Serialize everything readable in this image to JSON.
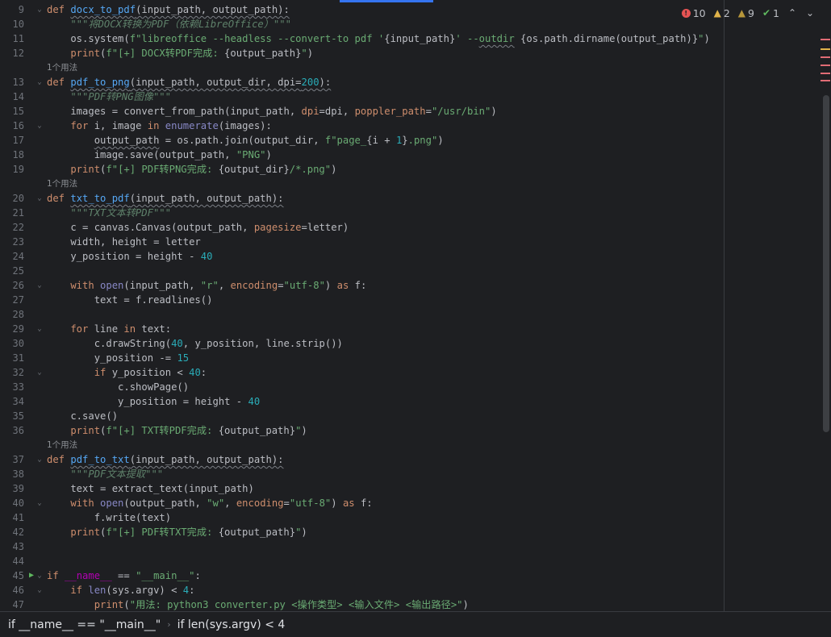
{
  "inspections": {
    "errors": "10",
    "warnings": "2",
    "weak_warnings": "9",
    "ok": "1"
  },
  "usage_hint": "1个用法",
  "breadcrumb": [
    "if __name__ == \"__main__\"",
    "if len(sys.argv) < 4"
  ],
  "lines": [
    {
      "n": "9",
      "fold": "⌄",
      "toks": [
        [
          "kw",
          "def "
        ],
        [
          "fn sq",
          "docx_to_pdf"
        ],
        [
          "plain sq",
          "(input_path, output_path):"
        ]
      ]
    },
    {
      "n": "10",
      "toks": [
        [
          "doc",
          "    \"\"\"将DOCX转换为PDF（依赖LibreOffice）\"\"\""
        ]
      ]
    },
    {
      "n": "11",
      "toks": [
        [
          "plain",
          "    os.system("
        ],
        [
          "str",
          "f\"libreoffice --headless --convert-to pdf '"
        ],
        [
          "plain",
          "{input_path}"
        ],
        [
          "str",
          "' --"
        ],
        [
          "str sq",
          "outdir"
        ],
        [
          "str",
          " "
        ],
        [
          "plain",
          "{os.path.dirname(output_path)}"
        ],
        [
          "str",
          "\""
        ],
        [
          "plain",
          ")"
        ]
      ]
    },
    {
      "n": "12",
      "toks": [
        [
          "kw",
          "    print"
        ],
        [
          "plain",
          "("
        ],
        [
          "str",
          "f\"[+] DOCX转PDF完成: "
        ],
        [
          "plain",
          "{output_path}"
        ],
        [
          "str",
          "\""
        ],
        [
          "plain",
          ")"
        ]
      ]
    },
    {
      "hint": true
    },
    {
      "n": "13",
      "fold": "⌄",
      "toks": [
        [
          "kw",
          "def "
        ],
        [
          "fn sq",
          "pdf_to_png"
        ],
        [
          "plain sq",
          "(input_path, output_dir, dpi="
        ],
        [
          "num sq",
          "200"
        ],
        [
          "plain sq",
          "):"
        ]
      ]
    },
    {
      "n": "14",
      "toks": [
        [
          "doc",
          "    \"\"\"PDF转PNG图像\"\"\""
        ]
      ]
    },
    {
      "n": "15",
      "toks": [
        [
          "plain",
          "    images = convert_from_path(input_path, "
        ],
        [
          "param",
          "dpi"
        ],
        [
          "plain",
          "=dpi, "
        ],
        [
          "param",
          "poppler_path"
        ],
        [
          "plain",
          "="
        ],
        [
          "str",
          "\"/usr/bin\""
        ],
        [
          "plain",
          ")"
        ]
      ]
    },
    {
      "n": "16",
      "fold": "⌄",
      "toks": [
        [
          "kw",
          "    for "
        ],
        [
          "plain",
          "i, image "
        ],
        [
          "kw",
          "in "
        ],
        [
          "builtin",
          "enumerate"
        ],
        [
          "plain",
          "(images):"
        ]
      ]
    },
    {
      "n": "17",
      "toks": [
        [
          "plain",
          "        "
        ],
        [
          "plain sq",
          "output_path"
        ],
        [
          "plain",
          " = os.path.join(output_dir, "
        ],
        [
          "str",
          "f\"page_"
        ],
        [
          "plain",
          "{i + "
        ],
        [
          "num",
          "1"
        ],
        [
          "plain",
          "}"
        ],
        [
          "str",
          ".png\""
        ],
        [
          "plain",
          ")"
        ]
      ]
    },
    {
      "n": "18",
      "toks": [
        [
          "plain",
          "        image.save(output_path, "
        ],
        [
          "str",
          "\"PNG\""
        ],
        [
          "plain",
          ")"
        ]
      ]
    },
    {
      "n": "19",
      "toks": [
        [
          "kw",
          "    print"
        ],
        [
          "plain",
          "("
        ],
        [
          "str",
          "f\"[+] PDF转PNG完成: "
        ],
        [
          "plain",
          "{output_dir}"
        ],
        [
          "str",
          "/*.png\""
        ],
        [
          "plain",
          ")"
        ]
      ]
    },
    {
      "hint": true
    },
    {
      "n": "20",
      "fold": "⌄",
      "toks": [
        [
          "kw",
          "def "
        ],
        [
          "fn sq",
          "txt_to_pdf"
        ],
        [
          "plain sq",
          "(input_path, output_path):"
        ]
      ]
    },
    {
      "n": "21",
      "toks": [
        [
          "doc",
          "    \"\"\"TXT文本转PDF\"\"\""
        ]
      ]
    },
    {
      "n": "22",
      "toks": [
        [
          "plain",
          "    c = canvas.Canvas(output_path, "
        ],
        [
          "param",
          "pagesize"
        ],
        [
          "plain",
          "=letter)"
        ]
      ]
    },
    {
      "n": "23",
      "toks": [
        [
          "plain",
          "    width, height = letter"
        ]
      ]
    },
    {
      "n": "24",
      "toks": [
        [
          "plain",
          "    y_position = height - "
        ],
        [
          "num",
          "40"
        ]
      ]
    },
    {
      "n": "25",
      "toks": []
    },
    {
      "n": "26",
      "fold": "⌄",
      "toks": [
        [
          "kw",
          "    with "
        ],
        [
          "builtin",
          "open"
        ],
        [
          "plain",
          "(input_path, "
        ],
        [
          "str",
          "\"r\""
        ],
        [
          "plain",
          ", "
        ],
        [
          "param",
          "encoding"
        ],
        [
          "plain",
          "="
        ],
        [
          "str",
          "\"utf-8\""
        ],
        [
          "plain",
          ") "
        ],
        [
          "kw",
          "as "
        ],
        [
          "plain",
          "f:"
        ]
      ]
    },
    {
      "n": "27",
      "toks": [
        [
          "plain",
          "        text = f.readlines()"
        ]
      ]
    },
    {
      "n": "28",
      "toks": []
    },
    {
      "n": "29",
      "fold": "⌄",
      "toks": [
        [
          "kw",
          "    for "
        ],
        [
          "plain",
          "line "
        ],
        [
          "kw",
          "in "
        ],
        [
          "plain",
          "text:"
        ]
      ]
    },
    {
      "n": "30",
      "toks": [
        [
          "plain",
          "        c.drawString("
        ],
        [
          "num",
          "40"
        ],
        [
          "plain",
          ", y_position, line.strip())"
        ]
      ]
    },
    {
      "n": "31",
      "toks": [
        [
          "plain",
          "        y_position -= "
        ],
        [
          "num",
          "15"
        ]
      ]
    },
    {
      "n": "32",
      "fold": "⌄",
      "toks": [
        [
          "kw",
          "        if "
        ],
        [
          "plain",
          "y_position < "
        ],
        [
          "num",
          "40"
        ],
        [
          "plain",
          ":"
        ]
      ]
    },
    {
      "n": "33",
      "toks": [
        [
          "plain",
          "            c.showPage()"
        ]
      ]
    },
    {
      "n": "34",
      "toks": [
        [
          "plain",
          "            y_position = height - "
        ],
        [
          "num",
          "40"
        ]
      ]
    },
    {
      "n": "35",
      "toks": [
        [
          "plain",
          "    c.save()"
        ]
      ]
    },
    {
      "n": "36",
      "toks": [
        [
          "kw",
          "    print"
        ],
        [
          "plain",
          "("
        ],
        [
          "str",
          "f\"[+] TXT转PDF完成: "
        ],
        [
          "plain",
          "{output_path}"
        ],
        [
          "str",
          "\""
        ],
        [
          "plain",
          ")"
        ]
      ]
    },
    {
      "hint": true
    },
    {
      "n": "37",
      "fold": "⌄",
      "toks": [
        [
          "kw",
          "def "
        ],
        [
          "fn sq",
          "pdf_to_txt"
        ],
        [
          "plain sq",
          "(input_path, output_path):"
        ]
      ]
    },
    {
      "n": "38",
      "toks": [
        [
          "doc",
          "    \"\"\"PDF文本提取\"\"\""
        ]
      ]
    },
    {
      "n": "39",
      "toks": [
        [
          "plain",
          "    text = extract_text(input_path)"
        ]
      ]
    },
    {
      "n": "40",
      "fold": "⌄",
      "toks": [
        [
          "kw",
          "    with "
        ],
        [
          "builtin",
          "open"
        ],
        [
          "plain",
          "(output_path, "
        ],
        [
          "str",
          "\"w\""
        ],
        [
          "plain",
          ", "
        ],
        [
          "param",
          "encoding"
        ],
        [
          "plain",
          "="
        ],
        [
          "str",
          "\"utf-8\""
        ],
        [
          "plain",
          ") "
        ],
        [
          "kw",
          "as "
        ],
        [
          "plain",
          "f:"
        ]
      ]
    },
    {
      "n": "41",
      "toks": [
        [
          "plain",
          "        f.write(text)"
        ]
      ]
    },
    {
      "n": "42",
      "toks": [
        [
          "kw",
          "    print"
        ],
        [
          "plain",
          "("
        ],
        [
          "str",
          "f\"[+] PDF转TXT完成: "
        ],
        [
          "plain",
          "{output_path}"
        ],
        [
          "str",
          "\""
        ],
        [
          "plain",
          ")"
        ]
      ]
    },
    {
      "n": "43",
      "toks": []
    },
    {
      "n": "44",
      "toks": []
    },
    {
      "n": "45",
      "fold": "⌄",
      "run": true,
      "toks": [
        [
          "kw",
          "if "
        ],
        [
          "dunder",
          "__name__"
        ],
        [
          "plain",
          " == "
        ],
        [
          "str",
          "\"__main__\""
        ],
        [
          "plain",
          ":"
        ]
      ]
    },
    {
      "n": "46",
      "fold": "⌄",
      "toks": [
        [
          "kw",
          "    if "
        ],
        [
          "builtin",
          "len"
        ],
        [
          "plain",
          "(sys.argv) < "
        ],
        [
          "num",
          "4"
        ],
        [
          "plain",
          ":"
        ]
      ]
    },
    {
      "n": "47",
      "toks": [
        [
          "kw",
          "        print"
        ],
        [
          "plain",
          "("
        ],
        [
          "str",
          "\"用法: python3 converter.py <操作类型> <输入文件> <输出路径>\""
        ],
        [
          "plain",
          ")"
        ]
      ]
    }
  ],
  "colors": {
    "background": "#1e1f22",
    "keyword": "#cf8e6d",
    "function": "#56a8f5",
    "string": "#6aab73",
    "number": "#2aacb8",
    "docstring": "#5f826b",
    "error": "#e06c75",
    "warning": "#e0b34a"
  }
}
